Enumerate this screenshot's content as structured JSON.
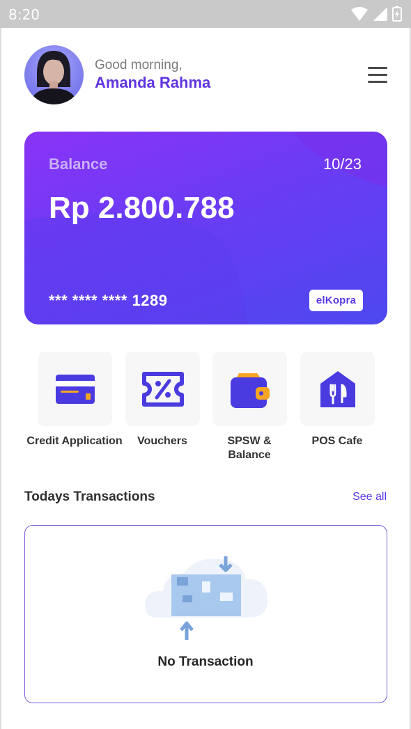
{
  "status_bar": {
    "time": "8:20"
  },
  "header": {
    "greeting": "Good morning,",
    "user_name": "Amanda Rahma"
  },
  "balance_card": {
    "label": "Balance",
    "period": "10/23",
    "amount": "Rp 2.800.788",
    "card_number": "*** **** **** 1289",
    "brand": "elKopra"
  },
  "menu": {
    "items": [
      {
        "label": "Credit Application",
        "icon": "credit-card-icon"
      },
      {
        "label": "Vouchers",
        "icon": "voucher-icon"
      },
      {
        "label": "SPSW & Balance",
        "icon": "wallet-icon"
      },
      {
        "label": "POS Cafe",
        "icon": "fork-knife-icon"
      }
    ]
  },
  "transactions": {
    "title": "Todays Transactions",
    "see_all": "See all",
    "empty_text": "No Transaction"
  },
  "colors": {
    "accent": "#6035e0",
    "card_gradient_start": "#8a33f6",
    "card_gradient_end": "#4d48ef",
    "icon_orange": "#f5a623",
    "border": "#7c5ad8"
  }
}
